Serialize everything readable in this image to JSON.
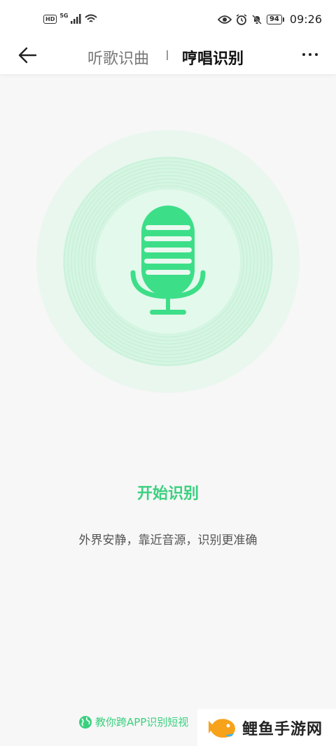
{
  "status_bar": {
    "hd_label": "HD",
    "signal_label": "5G",
    "battery_level": "94",
    "time": "09:26"
  },
  "nav": {
    "tab_listen": "听歌识曲",
    "tab_hum": "哼唱识别",
    "active_tab": "哼唱识别"
  },
  "main": {
    "start_label": "开始识别",
    "hint": "外界安静，靠近音源，识别更准确"
  },
  "footer": {
    "link_text": "教你跨APP识别短视"
  },
  "watermark": {
    "text": "鲤鱼手游网"
  },
  "colors": {
    "accent": "#3ad07e",
    "mic_green": "#3dde88",
    "ring_light": "#eaf7ef"
  },
  "icons": {
    "back": "arrow-left-icon",
    "more": "more-horizontal-icon",
    "mic": "microphone-icon",
    "globe": "globe-icon"
  }
}
